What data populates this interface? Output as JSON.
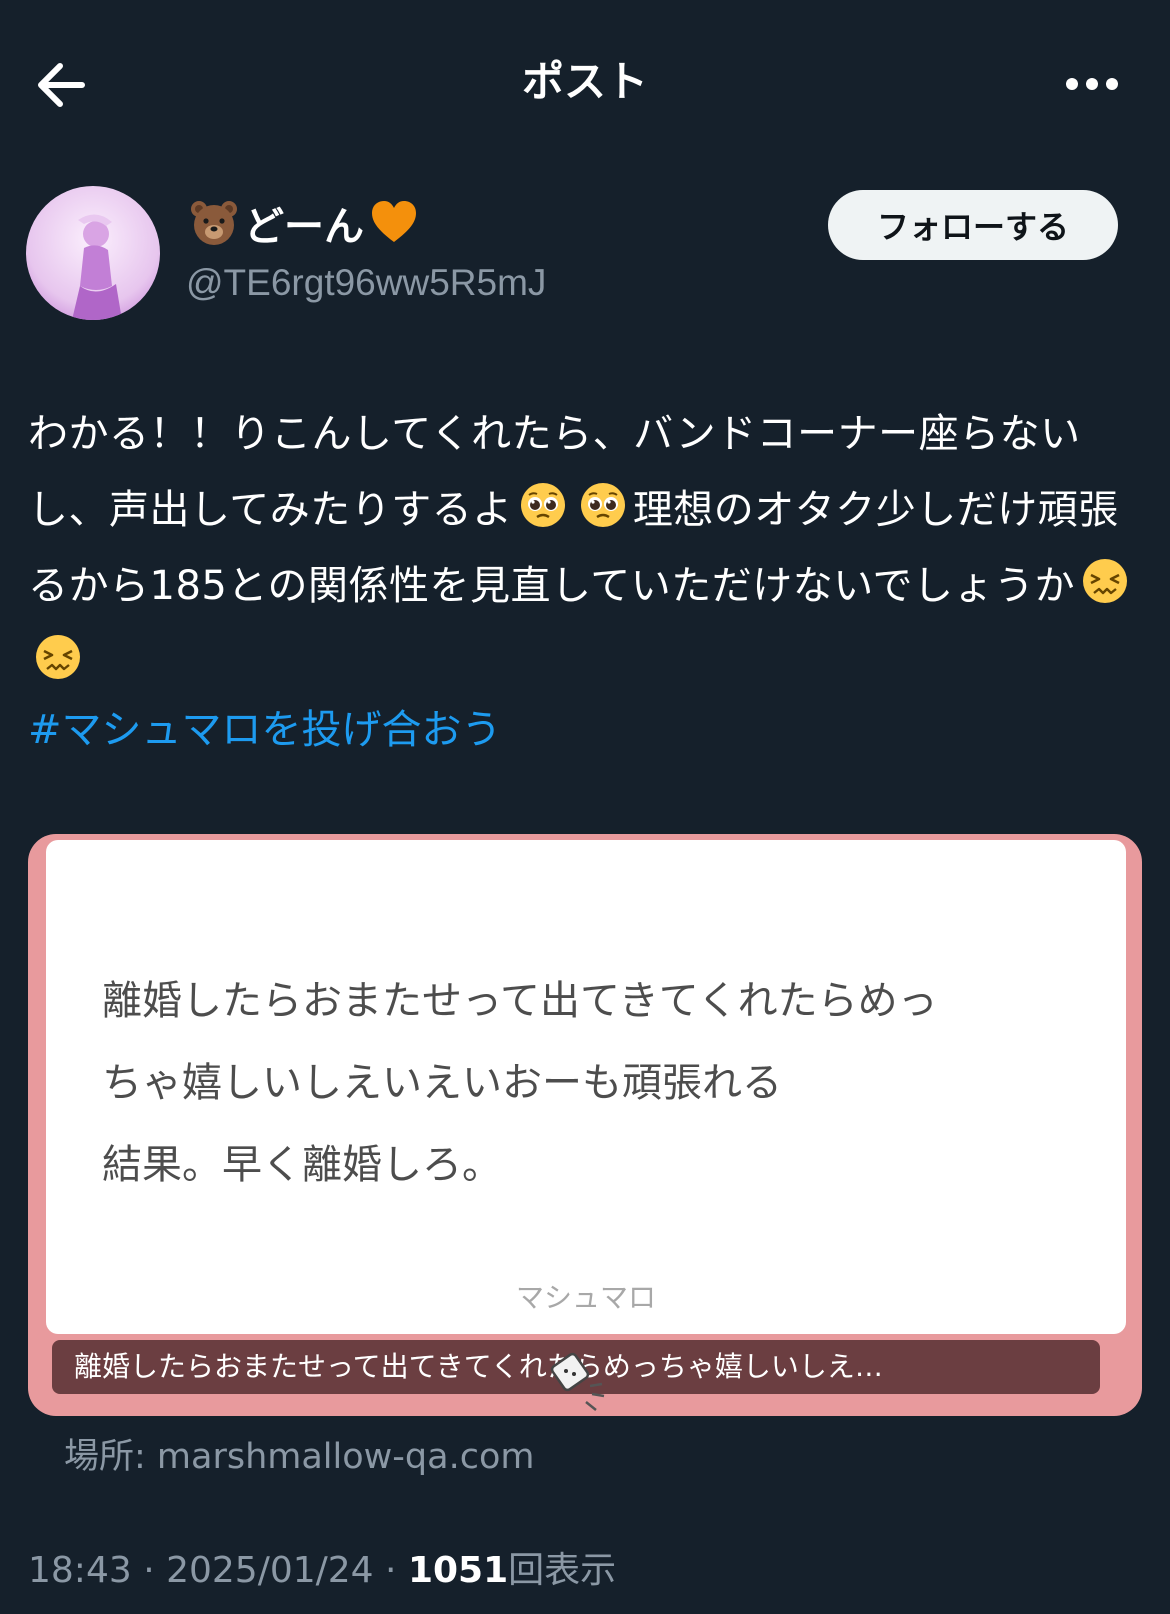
{
  "header": {
    "title": "ポスト"
  },
  "author": {
    "display_name": "どーん",
    "handle": "@TE6rgt96ww5R5mJ",
    "follow_label": "フォローする"
  },
  "post": {
    "text_part1": "わかる！！りこんしてくれたら、バンドコーナー座らないし、声出してみたりするよ",
    "text_part2": "理想のオタク少しだけ頑張るから185との関係性を見直していただけないでしょうか",
    "hashtag": "#マシュマロを投げ合おう"
  },
  "card": {
    "body_line1": "離婚したらおまたせって出てきてくれたらめっ",
    "body_line2": "ちゃ嬉しいしえいえいおーも頑張れる",
    "body_line3": "結果。早く離婚しろ。",
    "brand": "マシュマロ",
    "caption": "離婚したらおまたせって出てきてくれたらめっちゃ嬉しいしえ…"
  },
  "source": {
    "label": "場所: marshmallow-qa.com"
  },
  "meta": {
    "time": "18:43",
    "sep1": " · ",
    "date": "2025/01/24",
    "sep2": " · ",
    "views": "1051",
    "views_suffix": "回表示"
  },
  "colors": {
    "background": "#15202b",
    "hashtag": "#1d9bf0",
    "card_frame": "#e89a9d",
    "muted": "#8b98a5"
  },
  "icons": {
    "back": "arrow-left-icon",
    "more": "more-horizontal-icon",
    "name_prefix": "bear-face-emoji",
    "name_suffix": "orange-heart-emoji",
    "pleading": "pleading-face-emoji",
    "confounded": "confounded-face-emoji"
  }
}
